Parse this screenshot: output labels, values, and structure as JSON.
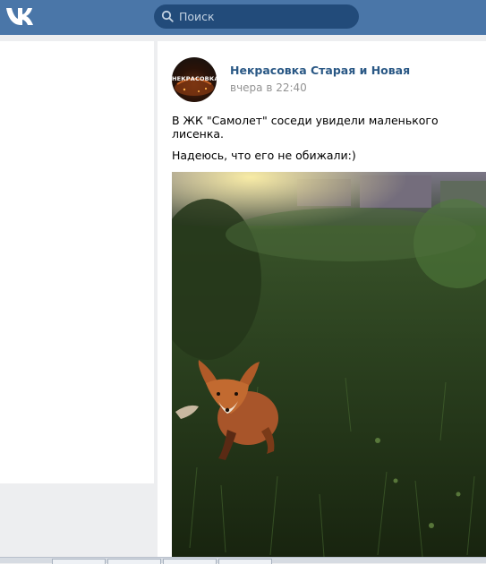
{
  "header": {
    "logo_icon": "vk-logo-icon",
    "search_placeholder": "Поиск",
    "search_icon": "search-icon",
    "accent_color": "#4a76a8"
  },
  "post": {
    "author": "Некрасовка Старая и Новая",
    "time": "вчера в 22:40",
    "avatar_text": "НЕКРАСОВКА",
    "text_line_1": "В ЖК \"Самолет\" соседи увидели маленького лисенка.",
    "text_line_2": "Надеюсь, что его не обижали:)",
    "photo_subject": "fox-cub-in-grass"
  }
}
